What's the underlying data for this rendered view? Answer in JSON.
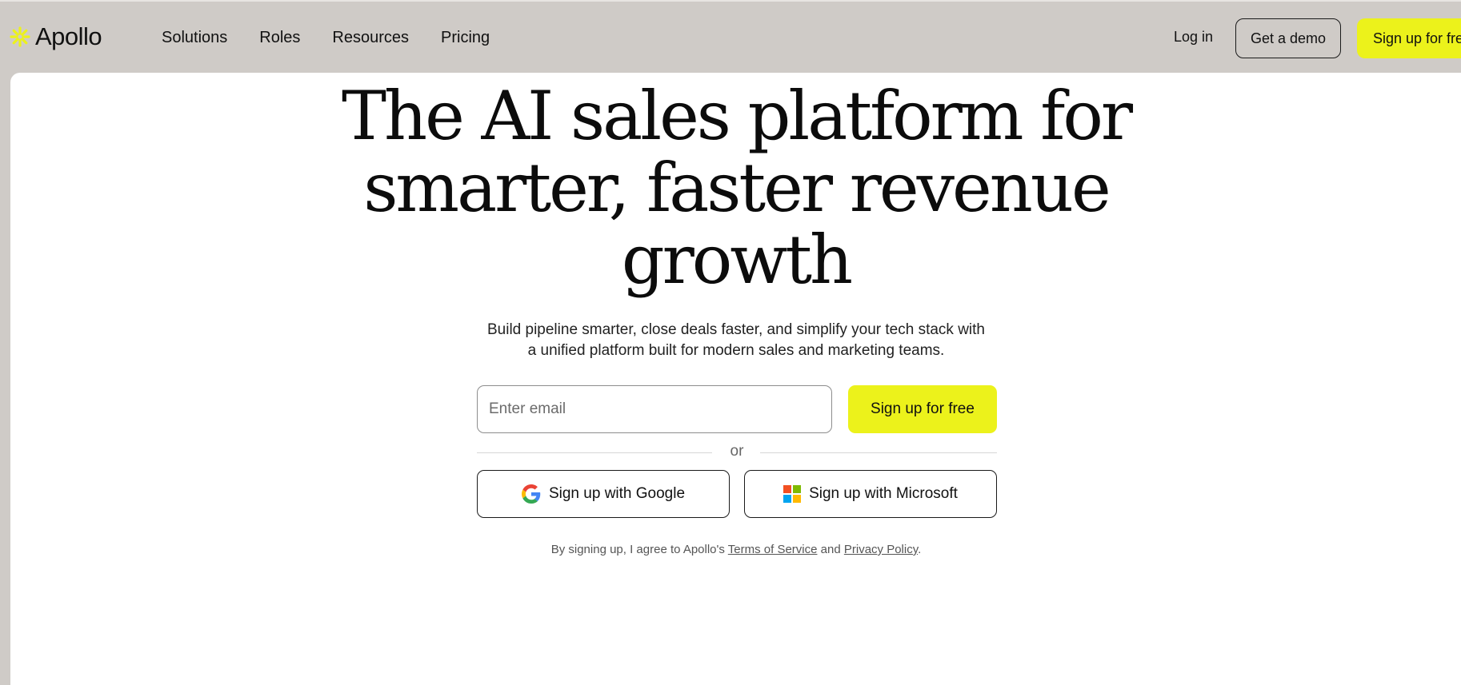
{
  "header": {
    "brand": "Apollo",
    "brand_color": "#ecf21b",
    "logo_icon": "asterisk-sun-icon",
    "nav": [
      {
        "label": "Solutions"
      },
      {
        "label": "Roles"
      },
      {
        "label": "Resources"
      },
      {
        "label": "Pricing"
      }
    ],
    "login_label": "Log in",
    "demo_label": "Get a demo",
    "signup_label": "Sign up for free"
  },
  "hero": {
    "title_lines": [
      "The AI sales platform for",
      "smarter, faster revenue",
      "growth"
    ],
    "subtitle_lines": [
      "Build pipeline smarter, close deals faster, and simplify your tech stack with",
      "a unified platform built for modern sales and marketing teams."
    ]
  },
  "signup_form": {
    "email_placeholder": "Enter email",
    "email_value": "",
    "submit_label": "Sign up for free",
    "divider_text": "or",
    "google_label": "Sign up with Google",
    "google_icon": "google-logo-icon",
    "microsoft_label": "Sign up with Microsoft",
    "microsoft_icon": "microsoft-logo-icon"
  },
  "legal": {
    "prefix": "By signing up, I agree to Apollo's ",
    "terms_label": "Terms of Service",
    "middle": " and ",
    "privacy_label": "Privacy Policy",
    "suffix": "."
  },
  "colors": {
    "page_bg": "#cfcbc7",
    "card_bg": "#ffffff",
    "accent": "#ecf21b",
    "text": "#111111"
  }
}
